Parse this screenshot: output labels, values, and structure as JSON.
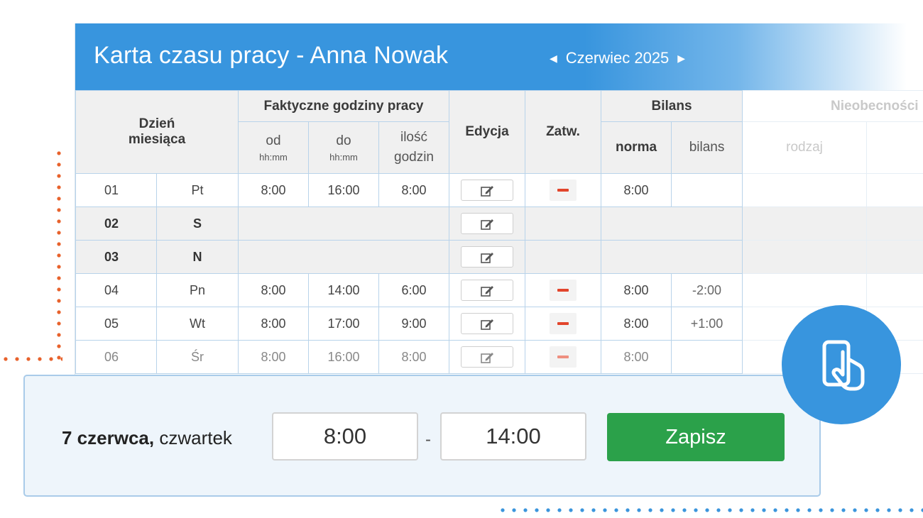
{
  "header": {
    "title": "Karta czasu pracy - Anna Nowak",
    "month": "Czerwiec 2025"
  },
  "table": {
    "col_day": "Dzień miesiąca",
    "col_actual": "Faktyczne godziny pracy",
    "col_from": "od",
    "col_to": "do",
    "col_hours": "ilość godzin",
    "format_hint": "hh:mm",
    "col_edit": "Edycja",
    "col_confirm": "Zatw.",
    "col_balance": "Bilans",
    "col_norm": "norma",
    "col_bal": "bilans",
    "col_absence": "Nieobecności",
    "col_type": "rodzaj",
    "rows": [
      {
        "day": "01",
        "weekday": "Pt",
        "from": "8:00",
        "to": "16:00",
        "hours": "8:00",
        "norm": "8:00",
        "balance": "",
        "weekend": false
      },
      {
        "day": "02",
        "weekday": "S",
        "from": "",
        "to": "",
        "hours": "",
        "norm": "",
        "balance": "",
        "weekend": true
      },
      {
        "day": "03",
        "weekday": "N",
        "from": "",
        "to": "",
        "hours": "",
        "norm": "",
        "balance": "",
        "weekend": true
      },
      {
        "day": "04",
        "weekday": "Pn",
        "from": "8:00",
        "to": "14:00",
        "hours": "6:00",
        "norm": "8:00",
        "balance": "-2:00",
        "weekend": false
      },
      {
        "day": "05",
        "weekday": "Wt",
        "from": "8:00",
        "to": "17:00",
        "hours": "9:00",
        "norm": "8:00",
        "balance": "+1:00",
        "weekend": false
      },
      {
        "day": "06",
        "weekday": "Śr",
        "from": "8:00",
        "to": "16:00",
        "hours": "8:00",
        "norm": "8:00",
        "balance": "",
        "weekend": false
      }
    ]
  },
  "entry": {
    "date_bold": "7 czerwca,",
    "date_rest": "czwartek",
    "from": "8:00",
    "separator": "-",
    "to": "14:00",
    "save_label": "Zapisz"
  },
  "icons": {
    "prev": "chevron-left-icon",
    "next": "chevron-right-icon",
    "edit": "edit-icon",
    "confirm": "minus-icon",
    "mobile": "mobile-touch-icon"
  },
  "colors": {
    "header_blue": "#3895de",
    "save_green": "#2ba14a",
    "minus_red": "#e2452c",
    "accent_orange": "#e8622c"
  }
}
